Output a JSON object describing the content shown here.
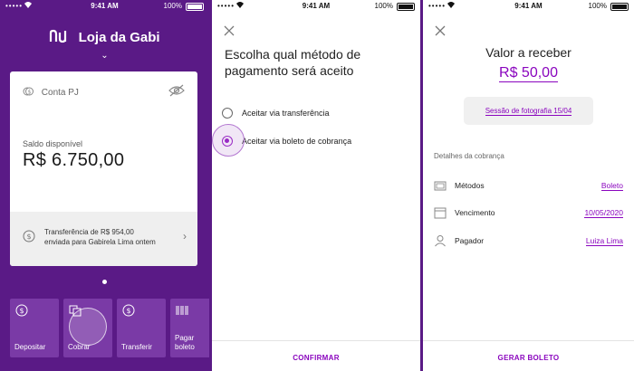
{
  "status_bar": {
    "carrier": "•••••",
    "time": "9:41 AM",
    "battery": "100%"
  },
  "screen1": {
    "brand": "Loja da Gabi",
    "card": {
      "account": "Conta PJ",
      "balance_label": "Saldo disponível",
      "balance": "R$ 6.750,00",
      "notice_line1": "Transferência de R$ 954,00",
      "notice_line2": "enviada para Gabirela Lima ontem"
    },
    "actions": [
      {
        "line1": "Depositar",
        "line2": ""
      },
      {
        "line1": "Cobrar",
        "line2": ""
      },
      {
        "line1": "Transferir",
        "line2": ""
      },
      {
        "line1": "Pagar",
        "line2": "boleto"
      }
    ]
  },
  "screen2": {
    "title": "Escolha qual método de pagamento será aceito",
    "options": [
      {
        "label": "Aceitar via transferência",
        "selected": false
      },
      {
        "label": "Aceitar via boleto de cobrança",
        "selected": true
      }
    ],
    "confirm_label": "CONFIRMAR"
  },
  "screen3": {
    "title": "Valor a receber",
    "amount": "R$ 50,00",
    "description": "Sessão de fotografia 15/04",
    "details_header": "Detalhes da cobrança",
    "rows": [
      {
        "label": "Métodos",
        "value": "Boleto"
      },
      {
        "label": "Vencimento",
        "value": "10/05/2020"
      },
      {
        "label": "Pagador",
        "value": "Luiza Lima"
      }
    ],
    "generate_label": "GERAR BOLETO"
  },
  "colors": {
    "brand_purple": "#5a1a86",
    "accent": "#8a05be",
    "action_tile": "#7a3aa6"
  }
}
